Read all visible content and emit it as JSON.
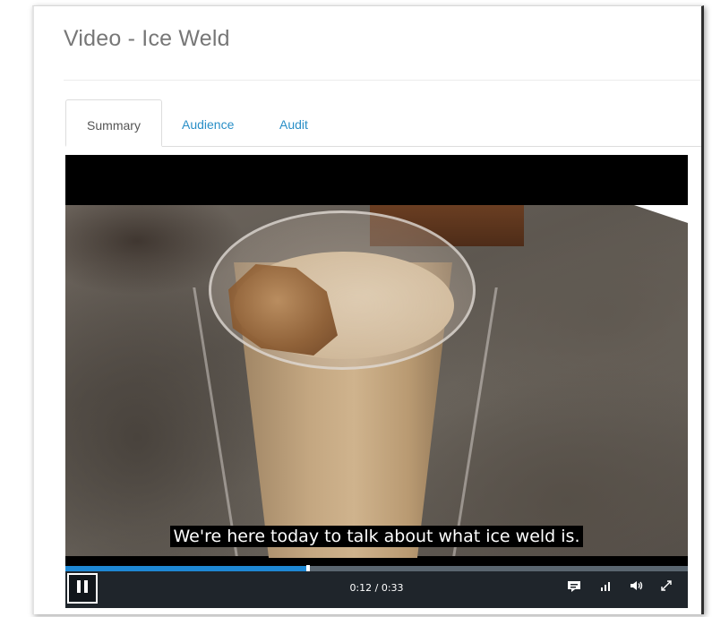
{
  "page": {
    "title": "Video - Ice Weld"
  },
  "tabs": [
    {
      "label": "Summary",
      "active": true
    },
    {
      "label": "Audience",
      "active": false
    },
    {
      "label": "Audit",
      "active": false
    }
  ],
  "player": {
    "caption": "We're here today to talk about what ice weld is.",
    "time_display": "0:12 / 0:33",
    "progress_fraction": 0.39,
    "icons": [
      "pause-icon",
      "captions-icon",
      "quality-icon",
      "volume-icon",
      "fullscreen-icon"
    ]
  },
  "colors": {
    "link": "#2a8fc7",
    "progress": "#1e88d4",
    "controls_bg": "#1f252b"
  }
}
